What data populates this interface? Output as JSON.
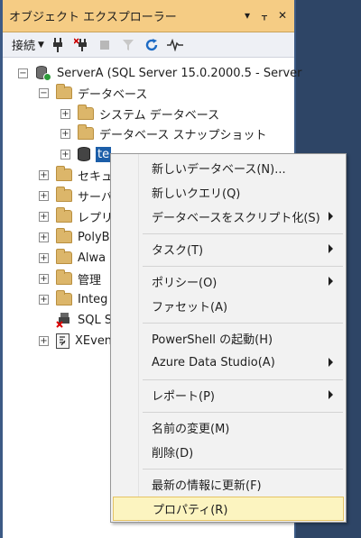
{
  "window": {
    "title": "オブジェクト エクスプローラー",
    "controls": [
      "▾",
      "ᚁ",
      "✕"
    ]
  },
  "toolbar": {
    "connect_label": "接続",
    "buttons": [
      "plug-icon",
      "disconnect-icon",
      "stop-icon",
      "filter-icon",
      "refresh-icon",
      "activity-icon"
    ]
  },
  "tree": {
    "server": "ServerA (SQL Server 15.0.2000.5 - Server",
    "databases": "データベース",
    "system_db": "システム データベース",
    "snapshots": "データベース スナップショット",
    "selected_db": "te",
    "security": "セキュ",
    "server_objects": "サーバ",
    "replication": "レプリ",
    "polybase": "PolyB",
    "always_on": "Alwa",
    "management": "管理",
    "integration": "Integ",
    "agent": "SQL S",
    "xevent": "XEven"
  },
  "context_menu": {
    "items": [
      {
        "label": "新しいデータベース(N)...",
        "submenu": false
      },
      {
        "label": "新しいクエリ(Q)",
        "submenu": false
      },
      {
        "label": "データベースをスクリプト化(S)",
        "submenu": true
      },
      {
        "label": "タスク(T)",
        "submenu": true
      },
      {
        "label": "ポリシー(O)",
        "submenu": true
      },
      {
        "label": "ファセット(A)",
        "submenu": false
      },
      {
        "label": "PowerShell の起動(H)",
        "submenu": false
      },
      {
        "label": "Azure Data Studio(A)",
        "submenu": true
      },
      {
        "label": "レポート(P)",
        "submenu": true
      },
      {
        "label": "名前の変更(M)",
        "submenu": false
      },
      {
        "label": "削除(D)",
        "submenu": false
      },
      {
        "label": "最新の情報に更新(F)",
        "submenu": false
      },
      {
        "label": "プロパティ(R)",
        "submenu": false,
        "highlighted": true
      }
    ]
  },
  "colors": {
    "title_bar": "#f5cc84",
    "selection": "#1c5ea8",
    "menu_highlight": "#fcf4c0",
    "frame": "#3c5a85"
  }
}
